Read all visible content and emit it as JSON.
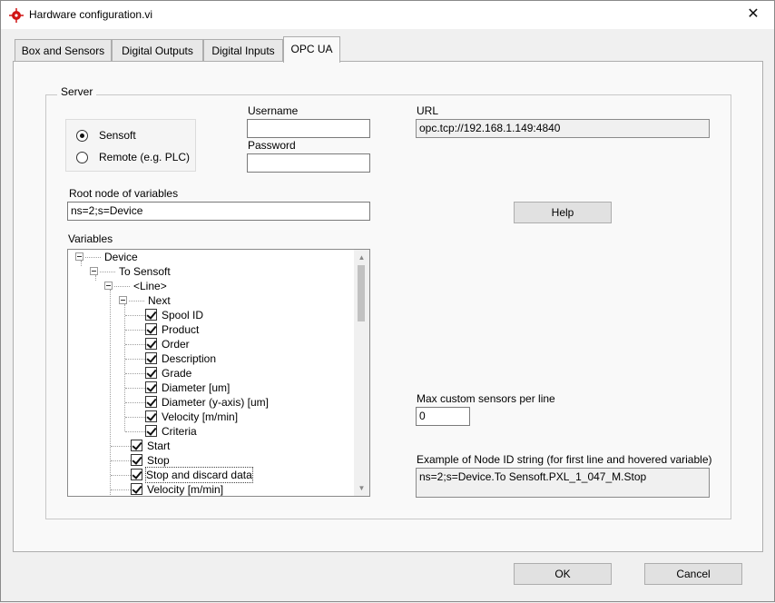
{
  "window": {
    "title": "Hardware configuration.vi",
    "close_glyph": "✕"
  },
  "tabs": [
    {
      "label": "Box and Sensors"
    },
    {
      "label": "Digital Outputs"
    },
    {
      "label": "Digital Inputs"
    },
    {
      "label": "OPC UA",
      "active": true
    }
  ],
  "server": {
    "group_title": "Server",
    "radio": [
      {
        "label": "Sensoft",
        "checked": true
      },
      {
        "label": "Remote (e.g. PLC)",
        "checked": false
      }
    ],
    "username_label": "Username",
    "username_value": "",
    "password_label": "Password",
    "password_value": "",
    "url_label": "URL",
    "url_value": "opc.tcp://192.168.1.149:4840",
    "root_label": "Root node of variables",
    "root_value": "ns=2;s=Device",
    "help_label": "Help",
    "variables_label": "Variables",
    "max_sensors_label": "Max custom sensors per line",
    "max_sensors_value": "0",
    "example_label": "Example of Node ID string (for first line and hovered variable)",
    "example_value": "ns=2;s=Device.To Sensoft.PXL_1_047_M.Stop"
  },
  "tree": [
    {
      "label": "Device",
      "level": 0,
      "expander": true
    },
    {
      "label": "To Sensoft",
      "level": 1,
      "expander": true
    },
    {
      "label": "<Line>",
      "level": 2,
      "expander": true
    },
    {
      "label": "Next",
      "level": 3,
      "expander": true
    },
    {
      "label": "Spool ID",
      "level": 4,
      "checked": true
    },
    {
      "label": "Product",
      "level": 4,
      "checked": true
    },
    {
      "label": "Order",
      "level": 4,
      "checked": true
    },
    {
      "label": "Description",
      "level": 4,
      "checked": true
    },
    {
      "label": "Grade",
      "level": 4,
      "checked": true
    },
    {
      "label": "Diameter [um]",
      "level": 4,
      "checked": true
    },
    {
      "label": "Diameter (y-axis) [um]",
      "level": 4,
      "checked": true
    },
    {
      "label": "Velocity [m/min]",
      "level": 4,
      "checked": true
    },
    {
      "label": "Criteria",
      "level": 4,
      "checked": true
    },
    {
      "label": "Start",
      "level": 3,
      "checked": true
    },
    {
      "label": "Stop",
      "level": 3,
      "checked": true
    },
    {
      "label": "Stop and discard data",
      "level": 3,
      "checked": true,
      "hovered": true
    },
    {
      "label": "Velocity [m/min]",
      "level": 3,
      "checked": true
    }
  ],
  "footer": {
    "ok_label": "OK",
    "cancel_label": "Cancel"
  },
  "colors": {
    "app_icon": "#d01515",
    "tree_line": "#a0a0a0"
  }
}
